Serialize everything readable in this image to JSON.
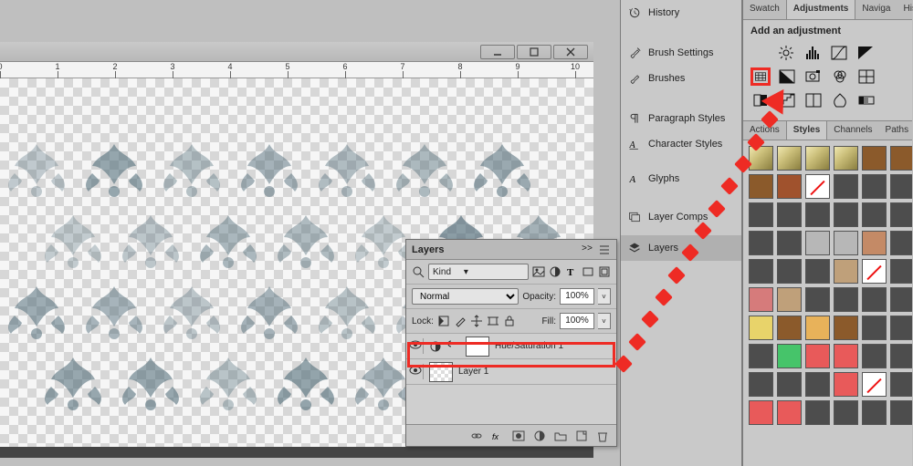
{
  "ruler_ticks": [
    "0",
    "1",
    "2",
    "3",
    "4",
    "5",
    "6",
    "7",
    "8",
    "9",
    "10"
  ],
  "window_controls": {
    "minimize": "minimize",
    "maximize": "maximize",
    "close": "close"
  },
  "panel_list": [
    {
      "icon": "history-icon",
      "label": "History"
    },
    {
      "icon": "brush-settings-icon",
      "label": "Brush Settings"
    },
    {
      "icon": "brushes-icon",
      "label": "Brushes"
    },
    {
      "icon": "paragraph-styles-icon",
      "label": "Paragraph Styles"
    },
    {
      "icon": "character-styles-icon",
      "label": "Character Styles"
    },
    {
      "icon": "glyphs-icon",
      "label": "Glyphs"
    },
    {
      "icon": "layer-comps-icon",
      "label": "Layer Comps"
    },
    {
      "icon": "layers-icon",
      "label": "Layers",
      "selected": true
    }
  ],
  "adjust_tabs": [
    {
      "label": "Swatch"
    },
    {
      "label": "Adjustments",
      "active": true
    },
    {
      "label": "Naviga"
    },
    {
      "label": "Hist"
    }
  ],
  "adjust_group_label": "Add an adjustment",
  "adjust_row1": [
    "brightness",
    "levels",
    "curves",
    "exposure"
  ],
  "adjust_row2": [
    "hue-saturation",
    "black-white",
    "photo-filter",
    "channel-mixer",
    "color-lookup"
  ],
  "adjust_row3": [
    "invert",
    "posterize",
    "threshold",
    "selective-color",
    "gradient-map"
  ],
  "styles_tabs": [
    {
      "label": "Actions"
    },
    {
      "label": "Styles",
      "active": true
    },
    {
      "label": "Channels"
    },
    {
      "label": "Paths"
    }
  ],
  "swatch_colors": [
    "bevel",
    "bevel",
    "bevel",
    "bevel",
    "#8b5a2b",
    "#8b5a2b",
    "#8b5a2b",
    "#a0522d",
    "cross",
    "#4d4d4d",
    "#4d4d4d",
    "#4d4d4d",
    "#4d4d4d",
    "#4d4d4d",
    "#4d4d4d",
    "#4d4d4d",
    "#4d4d4d",
    "#4d4d4d",
    "#4d4d4d",
    "#4d4d4d",
    "#b7b7b7",
    "#b7b7b7",
    "#c48a66",
    "#4d4d4d",
    "#4d4d4d",
    "#4d4d4d",
    "#4d4d4d",
    "#bfa07a",
    "cross",
    "#4d4d4d",
    "#d67b7b",
    "#bfa07a",
    "#4d4d4d",
    "#4d4d4d",
    "#4d4d4d",
    "#4d4d4d",
    "#e8d36a",
    "#8b5a2b",
    "#e8b25a",
    "#8b5a2b",
    "#4d4d4d",
    "#4d4d4d",
    "#4d4d4d",
    "#46c46a",
    "#e85a5a",
    "#e85a5a",
    "#4d4d4d",
    "#4d4d4d",
    "#4d4d4d",
    "#4d4d4d",
    "#4d4d4d",
    "#e85a5a",
    "cross",
    "#4d4d4d",
    "#e85a5a",
    "#e85a5a",
    "#4d4d4d",
    "#4d4d4d",
    "#4d4d4d",
    "#4d4d4d"
  ],
  "layers_panel": {
    "title": "Layers",
    "collapse_glyph": ">>",
    "filter_label": "Kind",
    "blend": "Normal",
    "opacity_label": "Opacity:",
    "opacity_value": "100%",
    "lock_label": "Lock:",
    "fill_label": "Fill:",
    "fill_value": "100%",
    "layers": [
      {
        "name": "Hue/Saturation 1",
        "kind": "adjustment",
        "highlight": true
      },
      {
        "name": "Layer 1",
        "kind": "image"
      }
    ],
    "footer_icons": [
      "link",
      "fx",
      "mask",
      "adjustment-circle",
      "group",
      "new",
      "trash"
    ]
  }
}
